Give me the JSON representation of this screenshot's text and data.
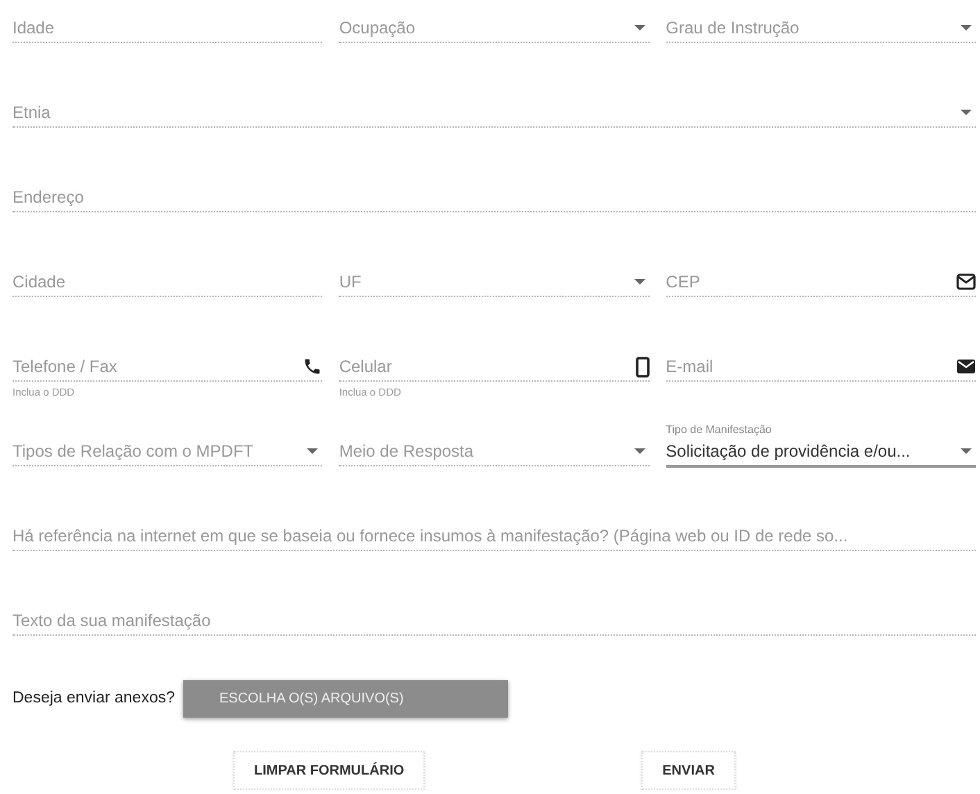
{
  "rows": [
    {
      "fields": [
        {
          "kind": "text",
          "placeholder": "Idade"
        },
        {
          "kind": "select",
          "label": "Ocupação"
        },
        {
          "kind": "select",
          "label": "Grau de Instrução"
        }
      ]
    },
    {
      "fields": [
        {
          "kind": "select",
          "label": "Etnia"
        }
      ]
    },
    {
      "fields": [
        {
          "kind": "text",
          "placeholder": "Endereço"
        }
      ]
    },
    {
      "fields": [
        {
          "kind": "text",
          "placeholder": "Cidade"
        },
        {
          "kind": "select",
          "label": "UF"
        },
        {
          "kind": "postcode",
          "placeholder": "CEP"
        }
      ]
    },
    {
      "fields": [
        {
          "kind": "phone",
          "placeholder": "Telefone / Fax",
          "hint": "Inclua o DDD"
        },
        {
          "kind": "mobile",
          "placeholder": "Celular",
          "hint": "Inclua o DDD"
        },
        {
          "kind": "email",
          "placeholder": "E-mail"
        }
      ]
    },
    {
      "fields": [
        {
          "kind": "select",
          "label": "Tipos de Relação com o MPDFT"
        },
        {
          "kind": "select",
          "label": "Meio de Resposta"
        },
        {
          "kind": "select",
          "label": "Tipo de Manifestação",
          "value": "Solicitação de providência e/ou..."
        }
      ]
    },
    {
      "fields": [
        {
          "kind": "text",
          "placeholder": "Há referência na internet em que se baseia ou fornece insumos à manifestação? (Página web ou ID de rede so..."
        }
      ]
    },
    {
      "fields": [
        {
          "kind": "text",
          "placeholder": "Texto da sua manifestação"
        }
      ]
    }
  ],
  "attachments": {
    "question": "Deseja enviar anexos?",
    "button": "ESCOLHA O(S) ARQUIVO(S)"
  },
  "actions": [
    "LIMPAR FORMULÁRIO",
    "ENVIAR"
  ]
}
